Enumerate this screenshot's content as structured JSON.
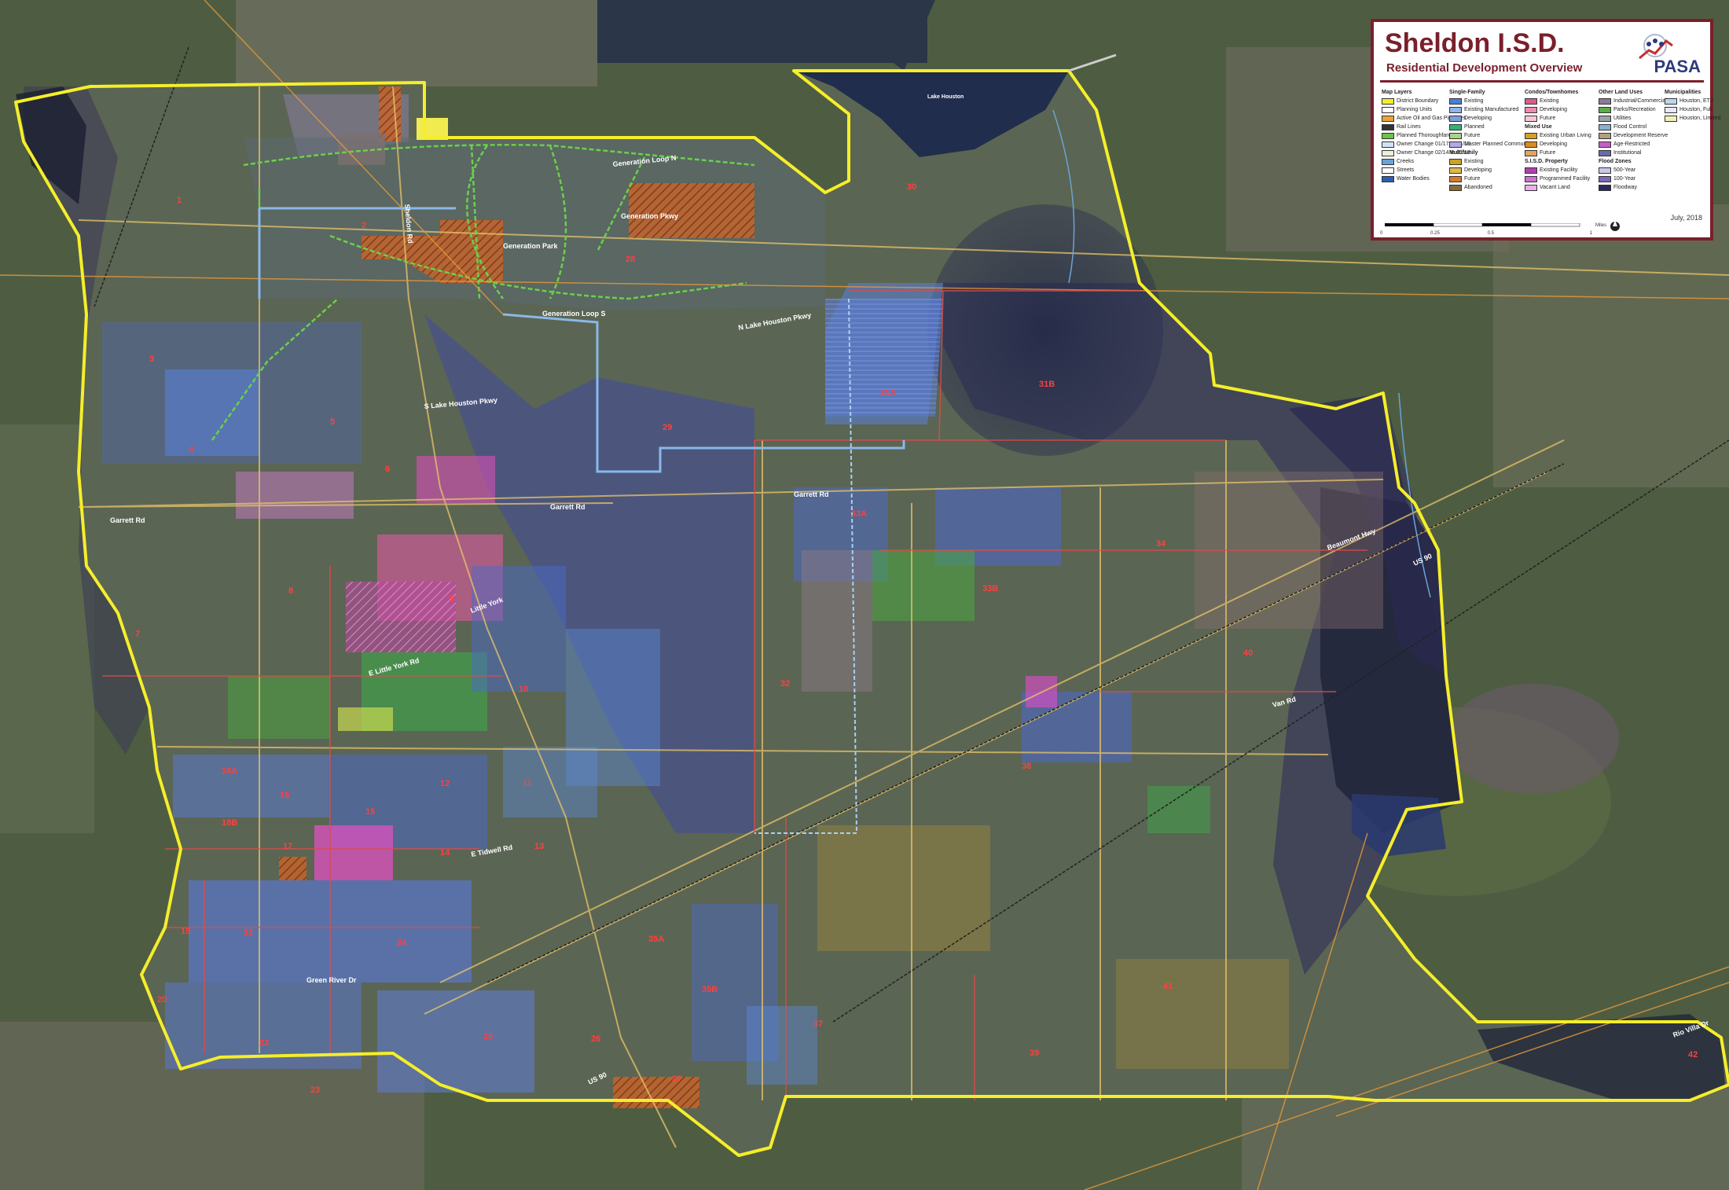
{
  "map": {
    "background": "#4a5a3e",
    "boundary_color": "#f5ee2a",
    "road_labels": {
      "generation_loop_n": "Generation Loop N",
      "generation_loop_s": "Generation Loop S",
      "generation_pkwy": "Generation Pkwy",
      "generation_park": "Generation Park",
      "n_lake_houston_pkwy": "N Lake Houston Pkwy",
      "s_lake_houston_pkwy": "S Lake Houston Pkwy",
      "garrett_rd_w": "Garrett Rd",
      "garrett_rd_e": "Garrett Rd",
      "garrett_rd_mid": "Garrett Rd",
      "sheldon_rd": "Sheldon Rd",
      "little_york": "Little York",
      "e_little_york": "E Little York Rd",
      "tidwell_rd": "E Tidwell Rd",
      "green_river_dr": "Green River Dr",
      "us_90_e": "US 90",
      "us_90_w": "US 90",
      "van_rd": "Van Rd",
      "rio_villa_dr": "Rio Villa Dr",
      "lake_houston": "Lake Houston",
      "beaumont_hwy": "Beaumont Hwy"
    },
    "planning_units": [
      "1",
      "2",
      "3",
      "4",
      "5",
      "6",
      "7",
      "8",
      "9",
      "10",
      "11",
      "12",
      "13",
      "14",
      "15",
      "16",
      "17",
      "18A",
      "18B",
      "19",
      "20",
      "21",
      "22",
      "23",
      "24",
      "25",
      "26",
      "27",
      "28",
      "29",
      "30",
      "31A",
      "31B",
      "32",
      "33A",
      "33B",
      "34",
      "35A",
      "35B",
      "37",
      "38",
      "39",
      "40",
      "41",
      "42"
    ]
  },
  "legend": {
    "title": "Sheldon I.S.D.",
    "subtitle": "Residential Development Overview",
    "logo_text": "PASA",
    "date": "July, 2018",
    "scale": {
      "ticks": [
        "0",
        "0.25",
        "0.5",
        "",
        "1"
      ],
      "units": "Miles"
    },
    "columns": [
      {
        "header": "Map Layers",
        "items": [
          {
            "label": "District Boundary",
            "color": "#f5ee2a"
          },
          {
            "label": "Planning Units",
            "color": "#ffffff"
          },
          {
            "label": "Active Oil and Gas Pipelines",
            "color": "#e8a33a"
          },
          {
            "label": "Rail Lines",
            "color": "#333333"
          },
          {
            "label": "Planned Thoroughfares",
            "color": "#6cc24a"
          },
          {
            "label": "Owner Change 01/17 to 01/18",
            "color": "#cfe3f7"
          },
          {
            "label": "Owner Change 02/14 to 01/17",
            "color": "#e7f3d4"
          },
          {
            "label": "Creeks",
            "color": "#6aa3d8"
          },
          {
            "label": "Streets",
            "color": "#ffffff"
          },
          {
            "label": "Water Bodies",
            "color": "#2a5fb8"
          }
        ]
      },
      {
        "header": "Single-Family",
        "items": [
          {
            "label": "Existing",
            "color": "#4a7fd6"
          },
          {
            "label": "Existing Manufactured",
            "color": "#8fb5e8"
          },
          {
            "label": "Developing",
            "color": "#7f9fd9"
          },
          {
            "label": "Planned",
            "color": "#2fb37a"
          },
          {
            "label": "Future",
            "color": "#a7d38a"
          },
          {
            "label": "Master Planned Community",
            "color": "#b7a7e0"
          },
          {
            "label": "Multifamily",
            "color": ""
          },
          {
            "label": "Existing",
            "color": "#c9a227"
          },
          {
            "label": "Developing",
            "color": "#e0b84a"
          },
          {
            "label": "Future",
            "color": "#d87a2a"
          },
          {
            "label": "Abandoned",
            "color": "#8a6a3a"
          }
        ]
      },
      {
        "header": "Condos/Townhomes",
        "items": [
          {
            "label": "Existing",
            "color": "#e05a8a"
          },
          {
            "label": "Developing",
            "color": "#f08ab0"
          },
          {
            "label": "Future",
            "color": "#f7c6d8"
          },
          {
            "label": "Mixed Use",
            "color": ""
          },
          {
            "label": "Existing Urban Living",
            "color": "#d6a020"
          },
          {
            "label": "Developing",
            "color": "#d98a20"
          },
          {
            "label": "Future",
            "color": "#e4a45a"
          },
          {
            "label": "S.I.S.D. Property",
            "color": ""
          },
          {
            "label": "Existing Facility",
            "color": "#b040b0"
          },
          {
            "label": "Programmed Facility",
            "color": "#d070d0"
          },
          {
            "label": "Vacant Land",
            "color": "#e8b0e8"
          }
        ]
      },
      {
        "header": "Other Land Uses",
        "items": [
          {
            "label": "Industrial/Commercial",
            "color": "#8a7a9a"
          },
          {
            "label": "Parks/Recreation",
            "color": "#5aaa4a"
          },
          {
            "label": "Utilities",
            "color": "#9aa2aa"
          },
          {
            "label": "Flood Control",
            "color": "#8ab0d0"
          },
          {
            "label": "Development Reserve",
            "color": "#b0a080"
          },
          {
            "label": "Age-Restricted",
            "color": "#c060c0"
          },
          {
            "label": "Institutional",
            "color": "#6a6aaa"
          },
          {
            "label": "Flood Zones",
            "color": ""
          },
          {
            "label": "500-Year",
            "color": "#c8c8e8"
          },
          {
            "label": "100-Year",
            "color": "#7a6ab8"
          },
          {
            "label": "Floodway",
            "color": "#2a2a5a"
          }
        ]
      },
      {
        "header": "Municipalities",
        "items": [
          {
            "label": "Houston, ETJ",
            "color": "#b8d8f0"
          },
          {
            "label": "Houston, Full",
            "color": "#e8e8f8"
          },
          {
            "label": "Houston, Limited",
            "color": "#f0f0b8"
          }
        ]
      }
    ]
  }
}
